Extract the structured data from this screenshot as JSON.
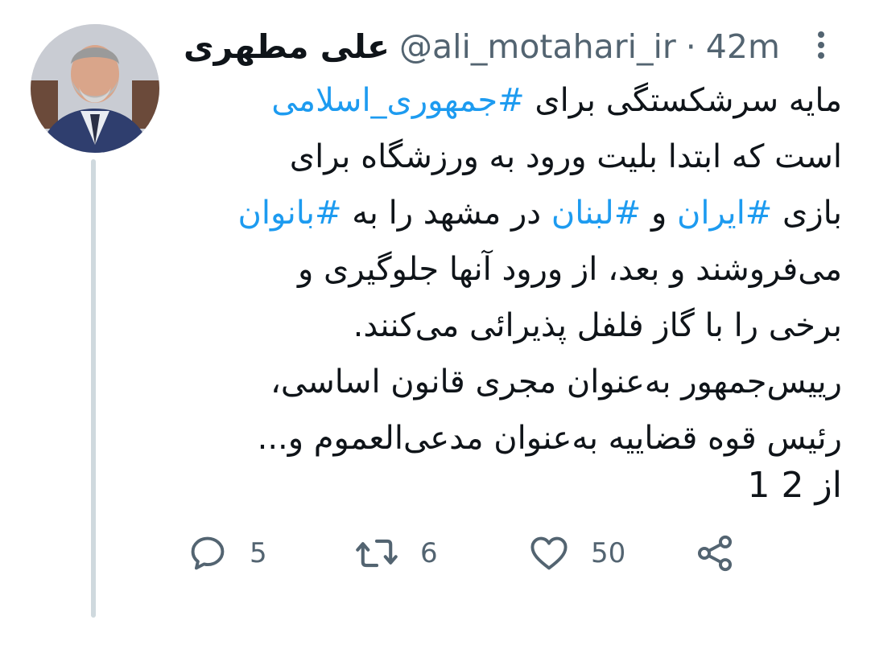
{
  "tweet": {
    "author_name": "علی مطهری",
    "handle": "@ali_motahari_ir",
    "separator": "·",
    "timestamp": "42m",
    "lines": [
      {
        "parts": [
          {
            "t": "مایه سرشکستگی برای ",
            "h": false
          },
          {
            "t": "#جمهوری_اسلامی",
            "h": true
          }
        ]
      },
      {
        "parts": [
          {
            "t": "است که ابتدا بلیت ورود به ورزشگاه برای",
            "h": false
          }
        ]
      },
      {
        "parts": [
          {
            "t": "بازی ",
            "h": false
          },
          {
            "t": "#ایران",
            "h": true
          },
          {
            "t": " و ",
            "h": false
          },
          {
            "t": "#لبنان",
            "h": true
          },
          {
            "t": " در مشهد را به ",
            "h": false
          },
          {
            "t": "#بانوان",
            "h": true
          }
        ]
      },
      {
        "parts": [
          {
            "t": "می‌فروشند و بعد، از ورود آنها جلوگیری و",
            "h": false
          }
        ]
      },
      {
        "parts": [
          {
            "t": "برخی را با گاز فلفل پذیرائی می‌کنند.",
            "h": false
          }
        ]
      },
      {
        "parts": [
          {
            "t": "رییس‌جمهور به‌عنوان مجری قانون اساسی،",
            "h": false
          }
        ]
      },
      {
        "parts": [
          {
            "t": "رئیس قوه قضاییه به‌عنوان مدعی‌العموم و...",
            "h": false
          }
        ]
      }
    ],
    "page_counter": "1 از 2"
  },
  "actions": {
    "reply_count": "5",
    "retweet_count": "6",
    "like_count": "50"
  },
  "icons": {
    "avatar": "profile-photo",
    "more": "more-vertical-icon",
    "reply": "reply-icon",
    "retweet": "retweet-icon",
    "like": "heart-icon",
    "share": "share-icon"
  },
  "colors": {
    "hashtag": "#1d9bf0",
    "text": "#0f1419",
    "muted": "#536471",
    "thread_line": "#cfd9de"
  }
}
